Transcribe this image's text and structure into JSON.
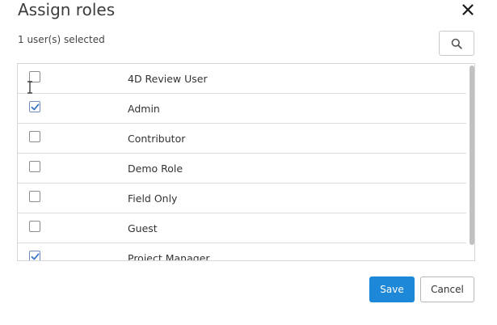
{
  "dialog": {
    "title": "Assign roles",
    "selection_summary": "1 user(s) selected",
    "close_icon": "close-icon",
    "search_icon": "search-icon"
  },
  "roles": [
    {
      "label": "4D Review User",
      "checked": false
    },
    {
      "label": "Admin",
      "checked": true
    },
    {
      "label": "Contributor",
      "checked": false
    },
    {
      "label": "Demo Role",
      "checked": false
    },
    {
      "label": "Field Only",
      "checked": false
    },
    {
      "label": "Guest",
      "checked": false
    },
    {
      "label": "Project Manager",
      "checked": true
    }
  ],
  "buttons": {
    "save_label": "Save",
    "cancel_label": "Cancel"
  },
  "colors": {
    "primary": "#1e88d8",
    "checkbox_check": "#3b78c4"
  }
}
